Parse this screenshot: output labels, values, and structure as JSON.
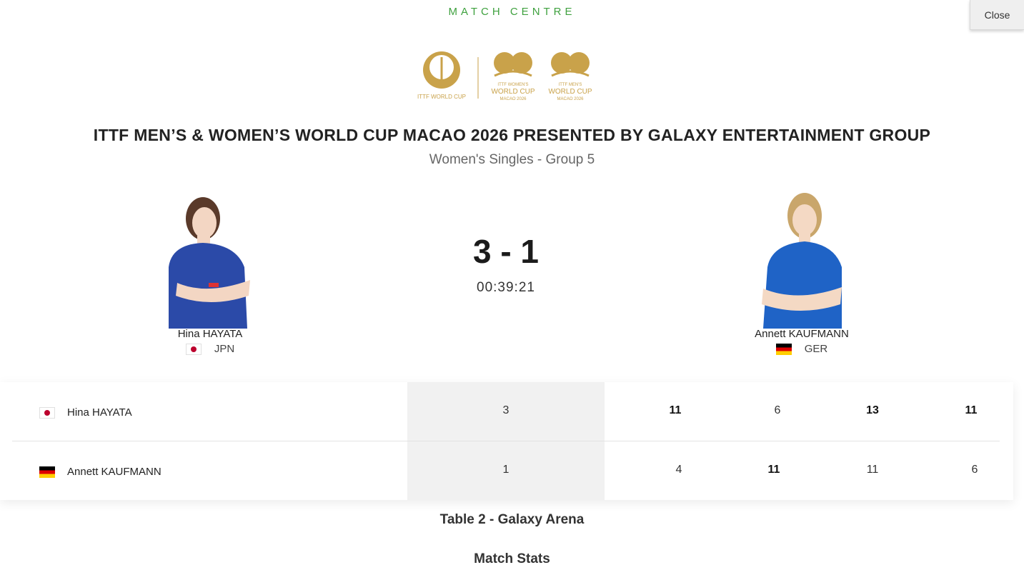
{
  "header": {
    "section_label": "MATCH CENTRE",
    "close_label": "Close"
  },
  "logos": {
    "logo1_text": "ITTF WORLD CUP",
    "logo2_line1": "ITTF WOMEN'S",
    "logo2_line2": "WORLD CUP",
    "logo2_line3": "MACAO 2026",
    "logo3_line1": "ITTF MEN'S",
    "logo3_line2": "WORLD CUP",
    "logo3_line3": "MACAO 2026",
    "gold_color": "#c9a24a"
  },
  "event": {
    "title": "ITTF MEN’S & WOMEN’S WORLD CUP MACAO 2026 PRESENTED BY GALAXY ENTERTAINMENT GROUP",
    "subtitle": "Women's Singles - Group 5"
  },
  "match": {
    "score": "3 - 1",
    "duration": "00:39:21",
    "venue": "Table 2 - Galaxy Arena",
    "stats_link": "Match Stats"
  },
  "players": [
    {
      "name": "Hina HAYATA",
      "country": "JPN",
      "flag": "flag-japan-icon",
      "jersey_color": "#2b4aa8",
      "match_games": "3",
      "games": [
        "11",
        "6",
        "13",
        "11"
      ],
      "game_wins": [
        true,
        false,
        true,
        true
      ]
    },
    {
      "name": "Annett KAUFMANN",
      "country": "GER",
      "flag": "flag-germany-icon",
      "jersey_color": "#1f63c6",
      "match_games": "1",
      "games": [
        "4",
        "11",
        "11",
        "6"
      ],
      "game_wins": [
        false,
        true,
        false,
        false
      ]
    }
  ],
  "colors": {
    "accent_green": "#3fa13f",
    "match_col_bg": "#f1f1f1"
  }
}
